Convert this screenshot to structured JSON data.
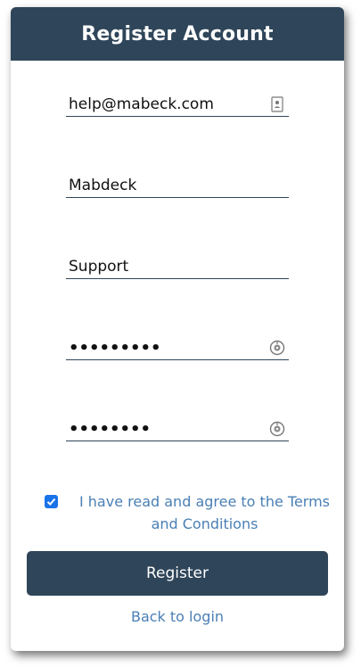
{
  "header": {
    "title": "Register Account"
  },
  "form": {
    "email": {
      "value": "help@mabeck.com",
      "icon": "contact-card-icon"
    },
    "company": {
      "value": "Mabdeck"
    },
    "department": {
      "value": "Support"
    },
    "password": {
      "value": "•••••••••",
      "icon": "eye-toggle-icon"
    },
    "confirm_password": {
      "value": "••••••••",
      "icon": "eye-toggle-icon"
    }
  },
  "terms": {
    "checked": true,
    "label": "I have read and agree to the Terms and Conditions"
  },
  "actions": {
    "register_label": "Register",
    "back_label": "Back to login"
  },
  "colors": {
    "primary": "#2f4559",
    "link": "#4a7fb5",
    "checkbox": "#1a73e8"
  }
}
